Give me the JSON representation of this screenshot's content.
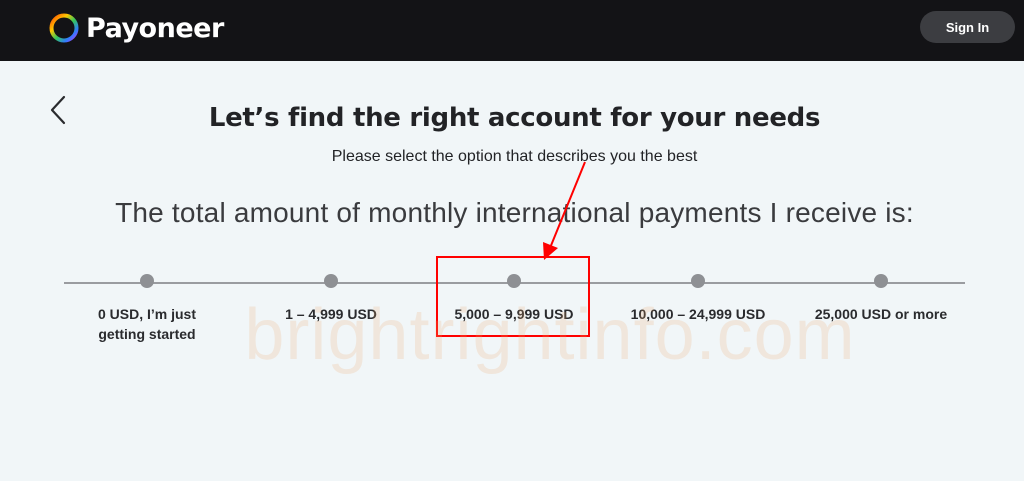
{
  "header": {
    "brand": "Payoneer",
    "signin_label": "Sign In"
  },
  "main": {
    "title": "Let’s find the right account for your needs",
    "subtitle": "Please select the option that describes you the best",
    "question": "The total amount of monthly international payments I receive is:",
    "options": [
      {
        "label": "0 USD, I’m just getting started"
      },
      {
        "label": "1 – 4,999 USD"
      },
      {
        "label": "5,000 – 9,999 USD"
      },
      {
        "label": "10,000 – 24,999 USD"
      },
      {
        "label": "25,000 USD or more"
      }
    ]
  },
  "overlay": {
    "watermark": "brightrightinfo.com",
    "annotation_color": "#ff0000"
  },
  "icons": {
    "logo": "payoneer-ring-icon",
    "back": "chevron-left-icon"
  }
}
